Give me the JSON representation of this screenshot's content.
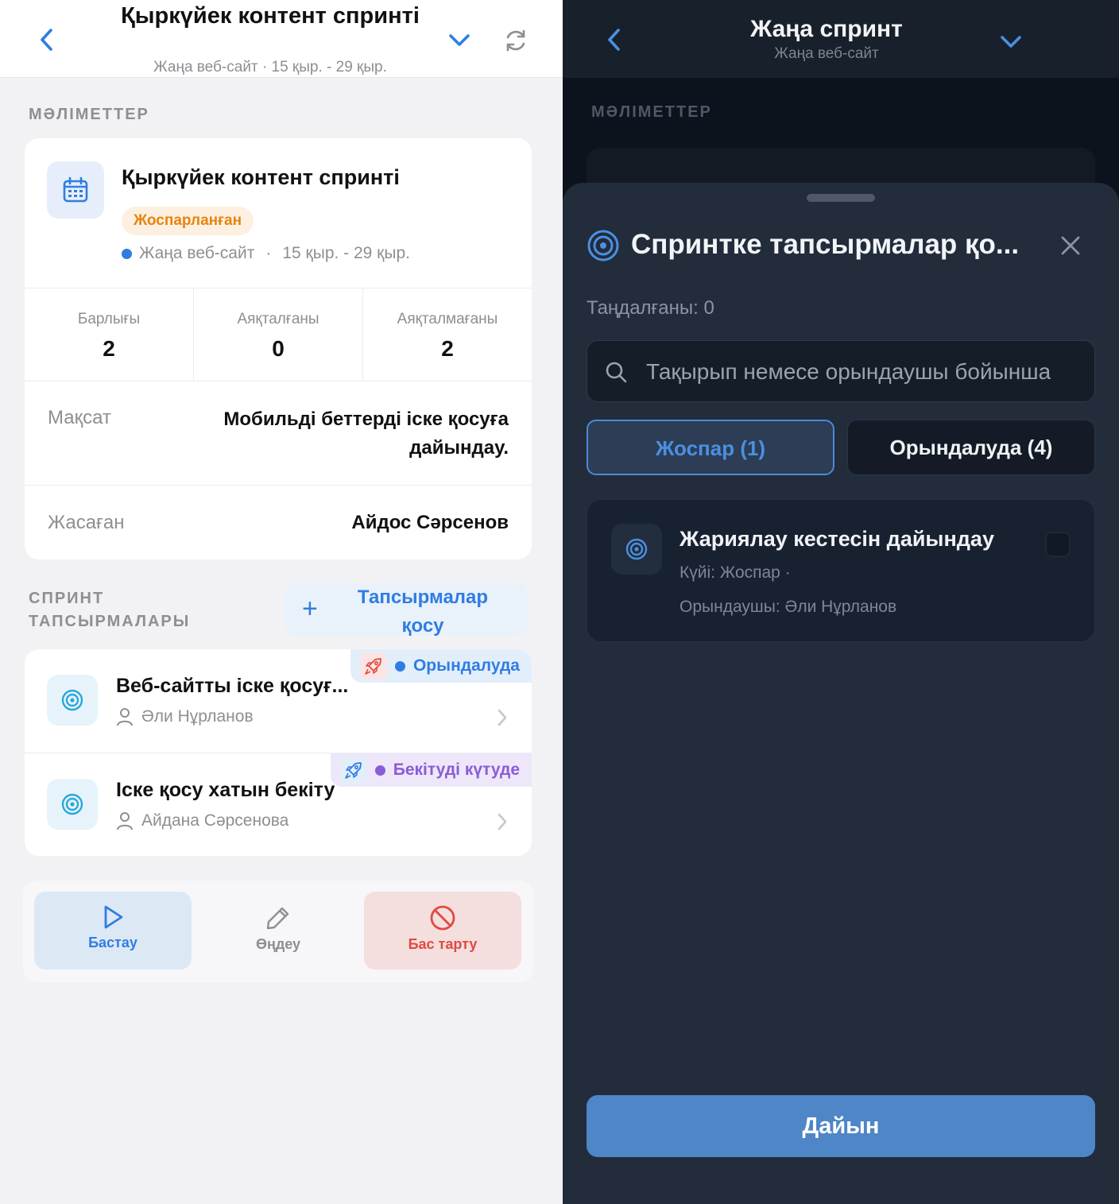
{
  "left": {
    "header": {
      "title": "Қыркүйек контент спринті",
      "subtitle": "Жаңа веб-сайт · 15 қыр. - 29 қыр."
    },
    "details_label": "МӘЛІМЕТТЕР",
    "sprint": {
      "title": "Қыркүйек контент спринті",
      "status": "Жоспарланған",
      "project": "Жаңа веб-сайт",
      "separator": "·",
      "dates": "15 қыр. - 29 қыр."
    },
    "stats": [
      {
        "label": "Барлығы",
        "value": "2"
      },
      {
        "label": "Аяқталғаны",
        "value": "0"
      },
      {
        "label": "Аяқталмағаны",
        "value": "2"
      }
    ],
    "goal": {
      "label": "Мақсат",
      "value_line1": "Мобильді беттерді іске қосуға",
      "value_line2": "дайындау."
    },
    "creator": {
      "label": "Жасаған",
      "value": "Айдос Сәрсенов"
    },
    "tasks_label_line1": "СПРИНТ",
    "tasks_label_line2": "ТАПСЫРМАЛАРЫ",
    "add_tasks": {
      "plus": "+",
      "line1": "Тапсырмалар",
      "line2": "қосу"
    },
    "tasks": [
      {
        "title": "Веб-сайтты іске қосуғ...",
        "assignee": "Әли Нұрланов",
        "status": "Орындалуда"
      },
      {
        "title": "Іске қосу хатын бекіту",
        "assignee": "Айдана Сәрсенова",
        "status": "Бекітуді күтуде"
      }
    ],
    "actions": {
      "start": "Бастау",
      "edit": "Өңдеу",
      "cancel": "Бас тарту"
    }
  },
  "right": {
    "header": {
      "title": "Жаңа спринт",
      "subtitle": "Жаңа веб-сайт"
    },
    "details_label": "МӘЛІМЕТТЕР",
    "sheet": {
      "title": "Спринтке тапсырмалар қо...",
      "selected": "Таңдалғаны: 0",
      "search_placeholder": "Тақырып немесе орындаушы бойынша",
      "tabs": {
        "plan": "Жоспар (1)",
        "in_progress": "Орындалуда (4)"
      },
      "item": {
        "title": "Жариялау кестесін дайындау",
        "status": "Күйі: Жоспар  ·",
        "assignee": "Орындаушы: Әли Нұрланов"
      },
      "done": "Дайын"
    }
  },
  "colors": {
    "accent": "#2f7de1",
    "planned": "#e6850e",
    "in_progress": "#2f7de1",
    "awaiting": "#8a5cd6",
    "cancel": "#e04a3f",
    "dark_bg": "#222c3b"
  }
}
